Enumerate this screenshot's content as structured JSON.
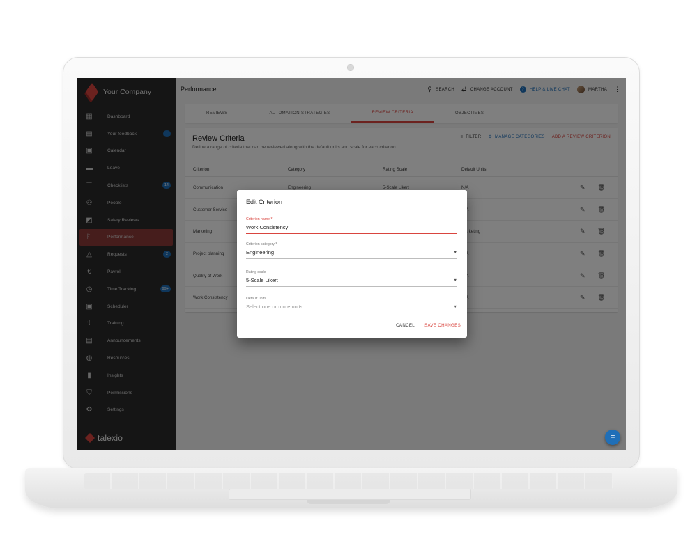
{
  "app": {
    "company_name": "Your Company",
    "product_name": "talexio",
    "accent_color": "#d9453f",
    "link_color": "#1f6fb8"
  },
  "sidebar": {
    "items": [
      {
        "label": "Dashboard",
        "icon": "dashboard-icon",
        "badge": ""
      },
      {
        "label": "Your feedback",
        "icon": "feedback-icon",
        "badge": "1"
      },
      {
        "label": "Calendar",
        "icon": "calendar-icon",
        "badge": ""
      },
      {
        "label": "Leave",
        "icon": "leave-icon",
        "badge": ""
      },
      {
        "label": "Checklists",
        "icon": "checklist-icon",
        "badge": "14"
      },
      {
        "label": "People",
        "icon": "people-icon",
        "badge": ""
      },
      {
        "label": "Salary Reviews",
        "icon": "salary-reviews-icon",
        "badge": ""
      },
      {
        "label": "Performance",
        "icon": "performance-icon",
        "badge": "",
        "active": true
      },
      {
        "label": "Requests",
        "icon": "requests-icon",
        "badge": "2"
      },
      {
        "label": "Payroll",
        "icon": "euro-icon",
        "badge": ""
      },
      {
        "label": "Time Tracking",
        "icon": "stopwatch-icon",
        "badge": "99+"
      },
      {
        "label": "Scheduler",
        "icon": "scheduler-icon",
        "badge": ""
      },
      {
        "label": "Training",
        "icon": "training-icon",
        "badge": ""
      },
      {
        "label": "Announcements",
        "icon": "announcements-icon",
        "badge": ""
      },
      {
        "label": "Resources",
        "icon": "globe-icon",
        "badge": ""
      },
      {
        "label": "Insights",
        "icon": "insights-icon",
        "badge": ""
      },
      {
        "label": "Permissions",
        "icon": "shield-icon",
        "badge": ""
      },
      {
        "label": "Settings",
        "icon": "gear-icon",
        "badge": ""
      }
    ]
  },
  "topbar": {
    "title": "Performance",
    "search": "SEARCH",
    "change_account": "CHANGE ACCOUNT",
    "help": "HELP & LIVE CHAT",
    "user": "MARTHA"
  },
  "tabs": [
    {
      "label": "REVIEWS"
    },
    {
      "label": "AUTOMATION STRATEGIES"
    },
    {
      "label": "REVIEW CRITERIA",
      "active": true
    },
    {
      "label": "OBJECTIVES"
    }
  ],
  "card": {
    "title": "Review Criteria",
    "subtitle": "Define a range of criteria that can be reviewed along with the default units and scale for each criterion.",
    "filter": "FILTER",
    "manage": "MANAGE CATEGORIES",
    "add": "ADD A REVIEW CRITERION",
    "columns": [
      "Criterion",
      "Category",
      "Rating Scale",
      "Default Units"
    ],
    "rows": [
      {
        "criterion": "Communication",
        "category": "Engineering",
        "scale": "5-Scale Likert",
        "units": "N/A"
      },
      {
        "criterion": "Customer Service",
        "category": "",
        "scale": "",
        "units": "N/A"
      },
      {
        "criterion": "Marketing",
        "category": "",
        "scale": "",
        "units": "Marketing"
      },
      {
        "criterion": "Project planning",
        "category": "",
        "scale": "",
        "units": "N/A"
      },
      {
        "criterion": "Quality of Work",
        "category": "",
        "scale": "",
        "units": "N/A"
      },
      {
        "criterion": "Work Consistency",
        "category": "",
        "scale": "",
        "units": "N/A"
      }
    ]
  },
  "dialog": {
    "title": "Edit Criterion",
    "name_label": "Criterion name *",
    "name_value": "Work Consistency",
    "category_label": "Criterion category *",
    "category_value": "Engineering",
    "scale_label": "Rating scale",
    "scale_value": "5-Scale Likert",
    "units_label": "Default units",
    "units_placeholder": "Select one or more units",
    "cancel": "CANCEL",
    "save": "SAVE CHANGES"
  }
}
